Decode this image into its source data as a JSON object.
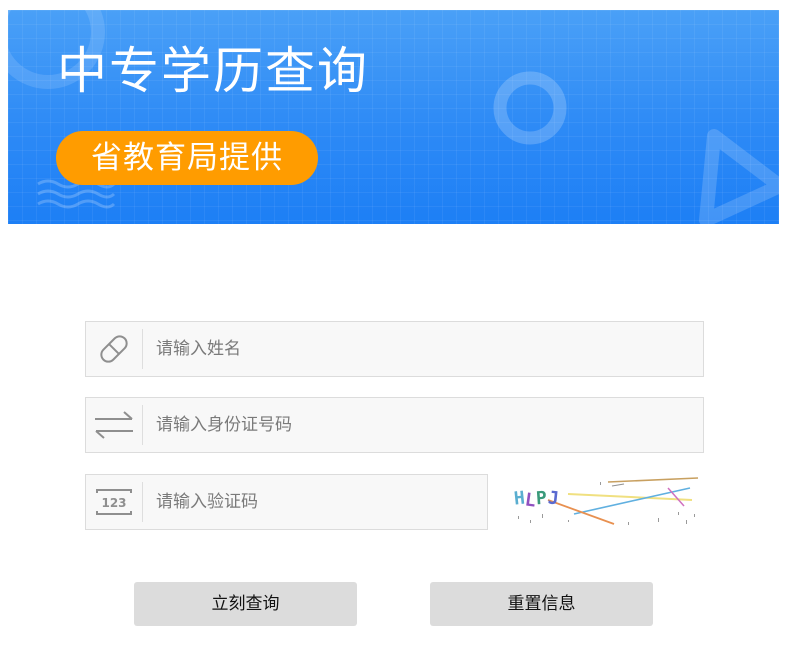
{
  "banner": {
    "title": "中专学历查询",
    "badge": "省教育局提供"
  },
  "form": {
    "name": {
      "placeholder": "请输入姓名",
      "value": "",
      "icon": "tag-icon"
    },
    "id_number": {
      "placeholder": "请输入身份证号码",
      "value": "",
      "icon": "swap-arrows-icon"
    },
    "code": {
      "placeholder": "请输入验证码",
      "value": "",
      "icon": "number-123-icon"
    },
    "captcha": {
      "text": "HLPJ"
    }
  },
  "buttons": {
    "query": "立刻查询",
    "reset": "重置信息"
  },
  "colors": {
    "banner_top": "#4aa0f7",
    "banner_bottom": "#1d7ff5",
    "badge": "#ff9c00",
    "button_bg": "#dcdcdc",
    "field_bg": "#f8f8f8",
    "field_border": "#dcdcdc"
  }
}
